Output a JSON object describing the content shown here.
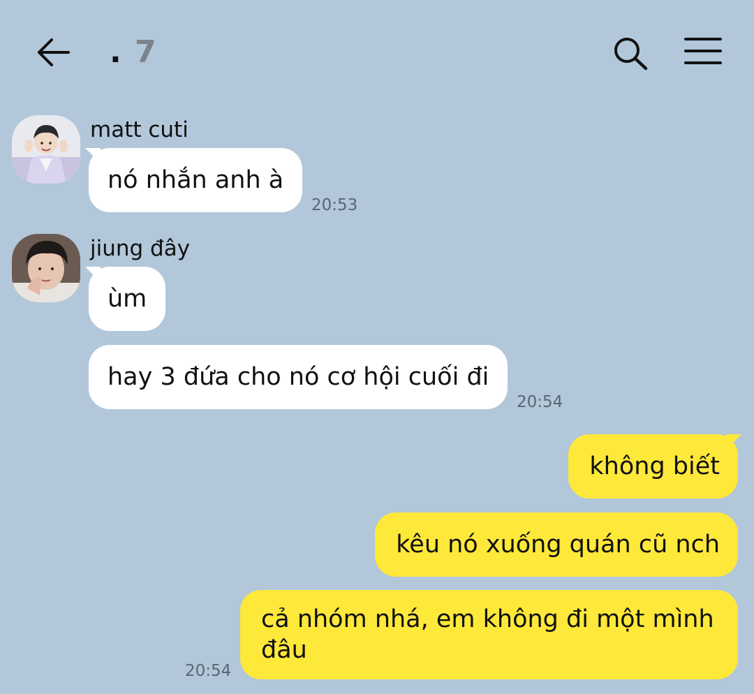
{
  "header": {
    "title_dot": ".",
    "title_count": "7",
    "back_icon": "arrow-left-icon",
    "search_icon": "search-icon",
    "menu_icon": "hamburger-menu-icon"
  },
  "colors": {
    "background": "#b2c7da",
    "incoming_bubble": "#ffffff",
    "outgoing_bubble": "#fee83a",
    "timestamp": "#5b6570"
  },
  "messages": [
    {
      "direction": "in",
      "sender": "matt cuti",
      "text": "nó nhắn anh à",
      "time": "20:53"
    },
    {
      "direction": "in",
      "sender": "jiung đây",
      "text": "ùm",
      "time": ""
    },
    {
      "direction": "in",
      "sender": "jiung đây",
      "text": "hay 3 đứa cho nó cơ hội cuối đi",
      "time": "20:54"
    },
    {
      "direction": "out",
      "text": "không biết",
      "time": ""
    },
    {
      "direction": "out",
      "text": "kêu nó xuống quán cũ nch",
      "time": ""
    },
    {
      "direction": "out",
      "text_line1": "cả nhóm nhá, em không đi một mình",
      "text_line2": "đâu",
      "time": "20:54"
    }
  ]
}
